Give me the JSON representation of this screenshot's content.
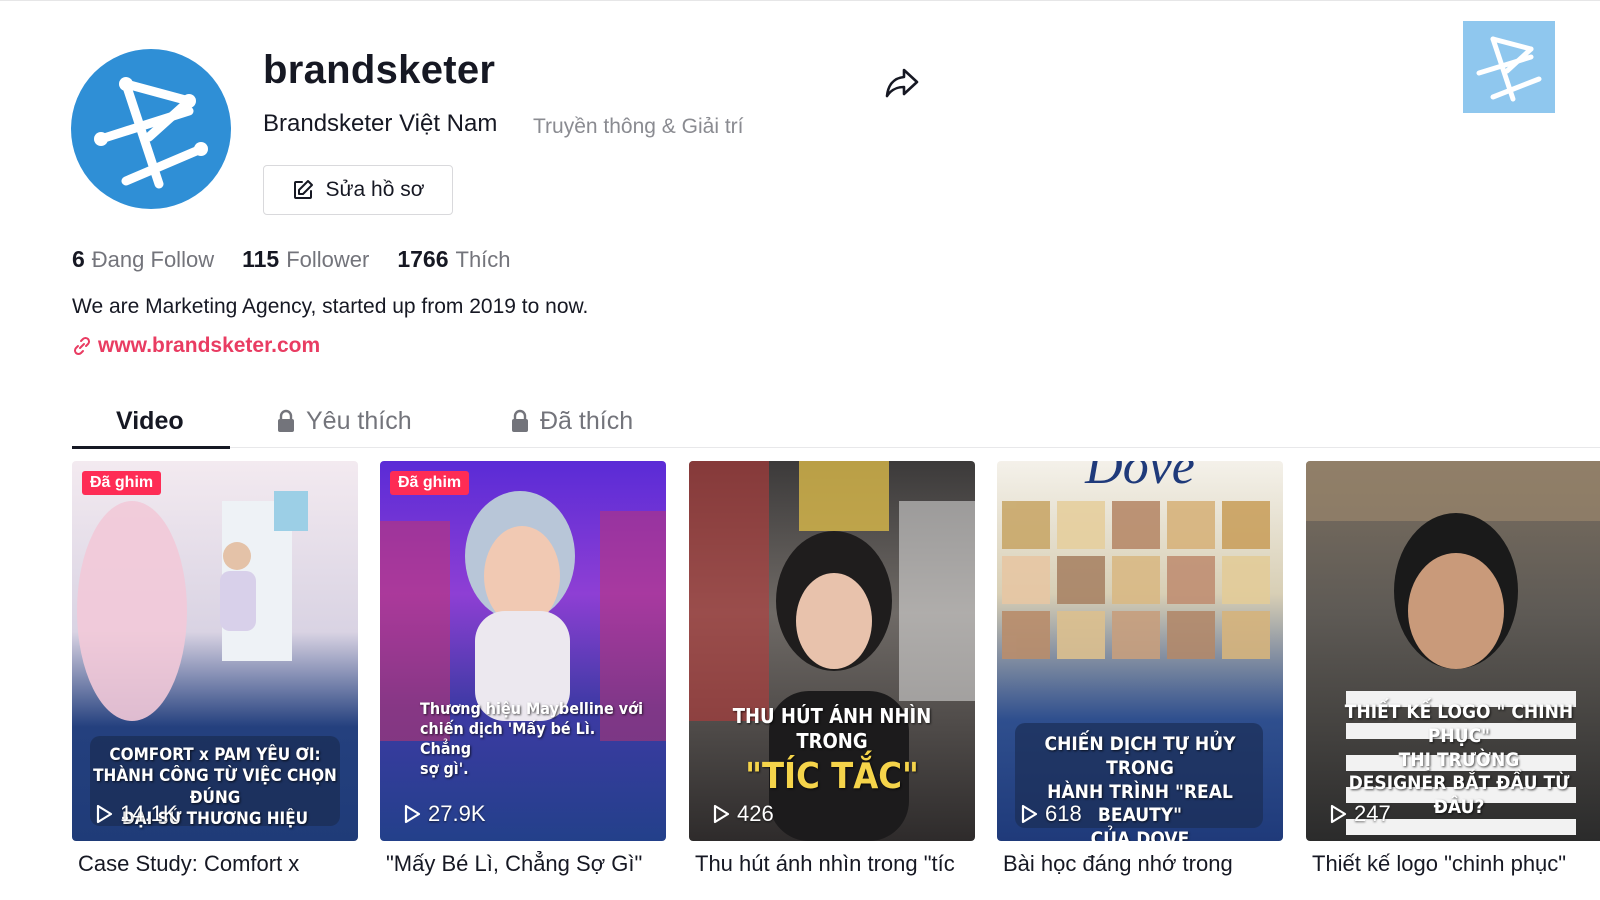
{
  "profile": {
    "username": "brandsketer",
    "display_name": "Brandsketer Việt Nam",
    "category": "Truyền thông & Giải trí",
    "edit_label": "Sửa hồ sơ",
    "bio": "We are Marketing Agency, started up from 2019 to now.",
    "link": "www.brandsketer.com"
  },
  "stats": {
    "following_count": "6",
    "following_label": "Đang Follow",
    "follower_count": "115",
    "follower_label": "Follower",
    "likes_count": "1766",
    "likes_label": "Thích"
  },
  "tabs": {
    "video": "Video",
    "favorites": "Yêu thích",
    "liked": "Đã thích"
  },
  "videos": [
    {
      "pinned": "Đã ghim",
      "views": "14.1K",
      "caption": "Case Study: Comfort x",
      "overlay": [
        "COMFORT x PAM YÊU ƠI:",
        "THÀNH CÔNG TỪ VIỆC CHỌN ĐÚNG",
        "ĐẠI SỨ THƯƠNG HIỆU"
      ]
    },
    {
      "pinned": "Đã ghim",
      "views": "27.9K",
      "caption": "\"Mấy Bé Lì, Chẳng Sợ Gì\"",
      "overlay": [
        "Thương hiệu Maybelline với",
        "chiến dịch 'Mấy bé Lì. Chẳng",
        "sợ gì'."
      ]
    },
    {
      "pinned": "",
      "views": "426",
      "caption": "Thu hút ánh nhìn trong \"tíc",
      "overlay": [
        "THU HÚT ÁNH NHÌN TRONG",
        "\"TÍC TẮC\""
      ]
    },
    {
      "pinned": "",
      "views": "618",
      "caption": "Bài học đáng nhớ trong",
      "overlay": [
        "CHIẾN DỊCH TỰ HỦY TRONG",
        "HÀNH TRÌNH \"REAL BEAUTY\"",
        "CỦA DOVE"
      ],
      "brand": "Dove"
    },
    {
      "pinned": "",
      "views": "247",
      "caption": "Thiết kế logo \"chinh phục\"",
      "overlay": [
        "THIẾT KẾ LOGO \" CHINH PHỤC\"",
        "THỊ TRƯỜNG",
        "DESIGNER BẮT ĐẦU TỪ ĐÂU?"
      ]
    }
  ],
  "colors": {
    "accent": "#fe2c55",
    "link": "#e93c62",
    "avatar_bg": "#2f8fd6"
  }
}
